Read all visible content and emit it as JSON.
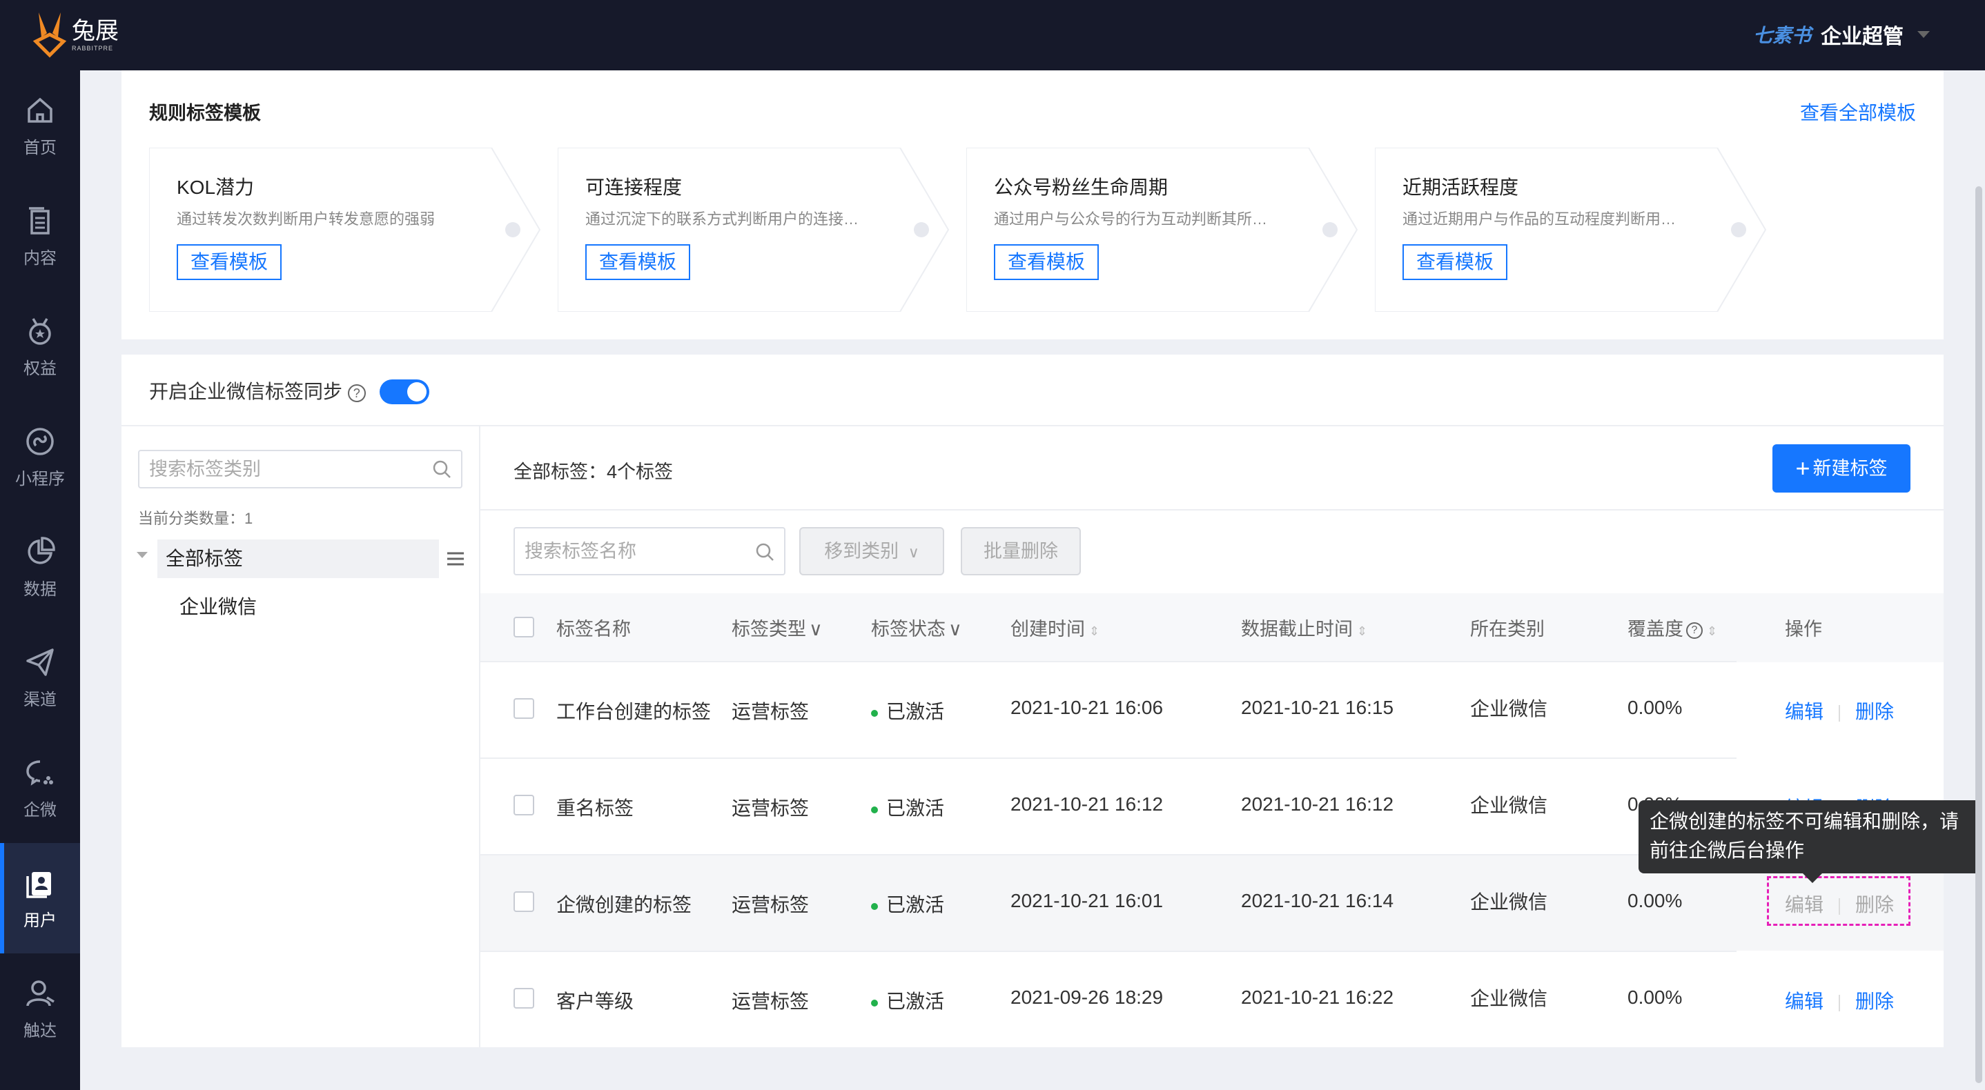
{
  "app": {
    "brand_name": "兔展",
    "brand_sub": "RABBITPRE",
    "brand_mini": "七素书",
    "user_role": "企业超管"
  },
  "sidebar": {
    "items": [
      {
        "label": "首页",
        "icon": "home-icon"
      },
      {
        "label": "内容",
        "icon": "document-icon"
      },
      {
        "label": "权益",
        "icon": "medal-icon"
      },
      {
        "label": "小程序",
        "icon": "miniapp-icon"
      },
      {
        "label": "数据",
        "icon": "pie-chart-icon"
      },
      {
        "label": "渠道",
        "icon": "send-icon"
      },
      {
        "label": "企微",
        "icon": "wecom-icon"
      },
      {
        "label": "用户",
        "icon": "user-book-icon",
        "active": true
      },
      {
        "label": "触达",
        "icon": "reach-user-icon"
      }
    ]
  },
  "templates": {
    "title": "规则标签模板",
    "view_all": "查看全部模板",
    "items": [
      {
        "title": "KOL潜力",
        "desc": "通过转发次数判断用户转发意愿的强弱",
        "button": "查看模板"
      },
      {
        "title": "可连接程度",
        "desc": "通过沉淀下的联系方式判断用户的连接…",
        "button": "查看模板"
      },
      {
        "title": "公众号粉丝生命周期",
        "desc": "通过用户与公众号的行为互动判断其所…",
        "button": "查看模板"
      },
      {
        "title": "近期活跃程度",
        "desc": "通过近期用户与作品的互动程度判断用…",
        "button": "查看模板"
      }
    ]
  },
  "sync": {
    "label": "开启企业微信标签同步",
    "help": "?",
    "enabled": true
  },
  "category": {
    "search_placeholder": "搜索标签类别",
    "count_text": "当前分类数量：1",
    "tree": [
      {
        "label": "全部标签"
      },
      {
        "label": "企业微信"
      }
    ]
  },
  "tags": {
    "summary": "全部标签：4个标签",
    "new_button": "新建标签",
    "search_placeholder": "搜索标签名称",
    "move_button": "移到类别",
    "batch_delete": "批量删除",
    "columns": [
      "标签名称",
      "标签类型",
      "标签状态",
      "创建时间",
      "数据截止时间",
      "所在类别",
      "覆盖度",
      "操作"
    ],
    "rows": [
      {
        "name": "工作台创建的标签",
        "type": "运营标签",
        "status": "已激活",
        "created": "2021-10-21 16:06",
        "deadline": "2021-10-21 16:15",
        "category": "企业微信",
        "coverage": "0.00%",
        "edit": "编辑",
        "delete": "删除"
      },
      {
        "name": "重名标签",
        "type": "运营标签",
        "status": "已激活",
        "created": "2021-10-21 16:12",
        "deadline": "2021-10-21 16:12",
        "category": "企业微信",
        "coverage": "0.00%",
        "edit": "编辑",
        "delete": "删除"
      },
      {
        "name": "企微创建的标签",
        "type": "运营标签",
        "status": "已激活",
        "created": "2021-10-21 16:01",
        "deadline": "2021-10-21 16:14",
        "category": "企业微信",
        "coverage": "0.00%",
        "edit": "编辑",
        "delete": "删除",
        "disabled": true
      },
      {
        "name": "客户等级",
        "type": "运营标签",
        "status": "已激活",
        "created": "2021-09-26 18:29",
        "deadline": "2021-10-21 16:22",
        "category": "企业微信",
        "coverage": "0.00%",
        "edit": "编辑",
        "delete": "删除"
      }
    ],
    "tooltip": "企微创建的标签不可编辑和删除，请前往企微后台操作"
  },
  "colors": {
    "primary": "#1677ff",
    "sidebar_bg": "#16192a",
    "status_green": "#22b14c",
    "highlight": "#e620b8"
  }
}
